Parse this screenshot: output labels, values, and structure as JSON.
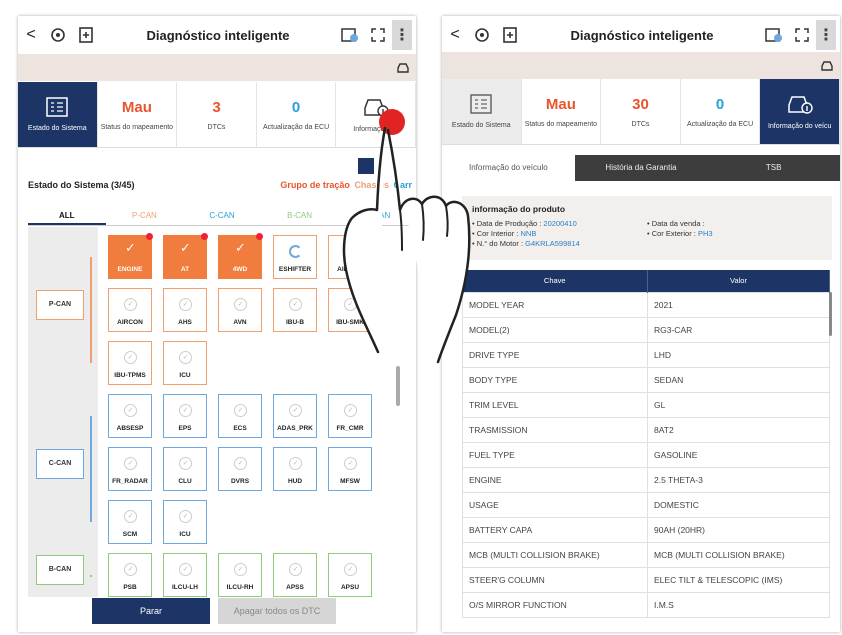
{
  "appbar": {
    "back": "<",
    "title": "Diagnóstico inteligente",
    "menu": "⋮"
  },
  "left": {
    "tiles": [
      {
        "value": "",
        "label": "Estado do Sistema"
      },
      {
        "value": "Mau",
        "label": "Status do mapeamento"
      },
      {
        "value": "3",
        "label": "DTCs"
      },
      {
        "value": "0",
        "label": "Actualização da ECU"
      },
      {
        "value": "",
        "label": "Informação do"
      }
    ],
    "section_title": "Estado do Sistema (3/45)",
    "legend": {
      "a": "Grupo de tração",
      "b": "Chassis",
      "c": "Carr"
    },
    "tabs": [
      "ALL",
      "P-CAN",
      "C-CAN",
      "B-CAN",
      "M-CAN"
    ],
    "can_labels": [
      "P-CAN",
      "C-CAN",
      "B-CAN"
    ],
    "modules": [
      {
        "name": "ENGINE",
        "bus": "p",
        "state": "error"
      },
      {
        "name": "AT",
        "bus": "p",
        "state": "error"
      },
      {
        "name": "4WD",
        "bus": "p",
        "state": "error"
      },
      {
        "name": "ESHIFTER",
        "bus": "p",
        "state": "loading"
      },
      {
        "name": "AIRBAG",
        "bus": "p",
        "state": "ok"
      },
      {
        "name": "AIRCON",
        "bus": "p",
        "state": "ok"
      },
      {
        "name": "AHS",
        "bus": "p",
        "state": "ok"
      },
      {
        "name": "AVN",
        "bus": "p",
        "state": "ok"
      },
      {
        "name": "IBU-B",
        "bus": "p",
        "state": "ok"
      },
      {
        "name": "IBU-SMK",
        "bus": "p",
        "state": "ok"
      },
      {
        "name": "IBU-TPMS",
        "bus": "p",
        "state": "ok"
      },
      {
        "name": "ICU",
        "bus": "p",
        "state": "ok"
      },
      {
        "name": "ABSESP",
        "bus": "c",
        "state": "ok"
      },
      {
        "name": "EPS",
        "bus": "c",
        "state": "ok"
      },
      {
        "name": "ECS",
        "bus": "c",
        "state": "ok"
      },
      {
        "name": "ADAS_PRK",
        "bus": "c",
        "state": "ok"
      },
      {
        "name": "FR_CMR",
        "bus": "c",
        "state": "ok"
      },
      {
        "name": "FR_RADAR",
        "bus": "c",
        "state": "ok"
      },
      {
        "name": "CLU",
        "bus": "c",
        "state": "ok"
      },
      {
        "name": "DVRS",
        "bus": "c",
        "state": "ok"
      },
      {
        "name": "HUD",
        "bus": "c",
        "state": "ok"
      },
      {
        "name": "MFSW",
        "bus": "c",
        "state": "ok"
      },
      {
        "name": "SCM",
        "bus": "c",
        "state": "ok"
      },
      {
        "name": "ICU",
        "bus": "c",
        "state": "ok"
      },
      {
        "name": "PSB",
        "bus": "b",
        "state": "ok"
      },
      {
        "name": "ILCU-LH",
        "bus": "b",
        "state": "ok"
      },
      {
        "name": "ILCU-RH",
        "bus": "b",
        "state": "ok"
      },
      {
        "name": "APSS",
        "bus": "b",
        "state": "ok"
      },
      {
        "name": "APSU",
        "bus": "b",
        "state": "ok"
      }
    ],
    "buttons": {
      "stop": "Parar",
      "clear": "Apagar todos os DTC"
    }
  },
  "right": {
    "tiles": [
      {
        "value": "",
        "label": "Estado do Sistema"
      },
      {
        "value": "Mau",
        "label": "Status do mapeamento"
      },
      {
        "value": "30",
        "label": "DTCs"
      },
      {
        "value": "0",
        "label": "Actualização da ECU"
      },
      {
        "value": "",
        "label": "Informação do veícu"
      }
    ],
    "tabs": [
      "Informação do veículo",
      "História da Garantia",
      "TSB"
    ],
    "product": {
      "heading": "informação do produto",
      "left": [
        {
          "k": "• Data de Produção : ",
          "v": "20200410"
        },
        {
          "k": "• Cor Interior : ",
          "v": "NNB"
        },
        {
          "k": "• N.° do Motor : ",
          "v": "G4KRLA599814"
        }
      ],
      "right": [
        {
          "k": "• Data da venda : ",
          "v": ""
        },
        {
          "k": "• Cor Exterior : ",
          "v": "PH3"
        }
      ]
    },
    "table": {
      "headers": [
        "Chave",
        "Valor"
      ],
      "rows": [
        [
          "MODEL YEAR",
          "2021"
        ],
        [
          "MODEL(2)",
          "RG3-CAR"
        ],
        [
          "DRIVE TYPE",
          "LHD"
        ],
        [
          "BODY TYPE",
          "SEDAN"
        ],
        [
          "TRIM LEVEL",
          "GL"
        ],
        [
          "TRASMISSION",
          "8AT2"
        ],
        [
          "FUEL TYPE",
          "GASOLINE"
        ],
        [
          "ENGINE",
          "2.5 THETA-3"
        ],
        [
          "USAGE",
          "DOMESTIC"
        ],
        [
          "BATTERY CAPA",
          "90AH (20HR)"
        ],
        [
          "MCB (MULTI COLLISION BRAKE)",
          "MCB (MULTI COLLISION BRAKE)"
        ],
        [
          "STEER'G COLUMN",
          "ELEC TILT & TELESCOPIC (IMS)"
        ],
        [
          "O/S MIRROR FUNCTION",
          "I.M.S"
        ]
      ]
    }
  },
  "colors": {
    "navy": "#1c3566",
    "orange": "#f07c3d",
    "pcan": "#f0a070",
    "ccan": "#6fa8dc",
    "bcan": "#8fcc7a"
  }
}
